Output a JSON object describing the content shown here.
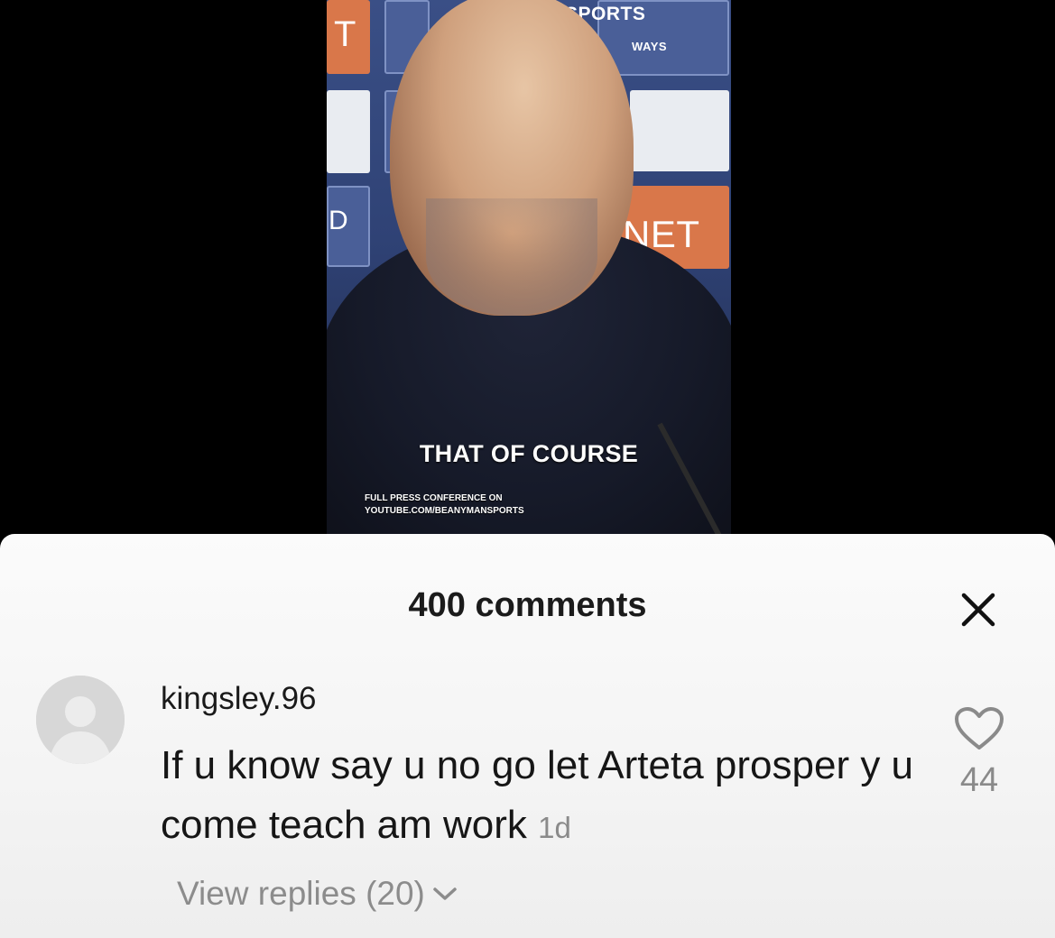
{
  "video": {
    "board_texts": [
      "SPORTS",
      "WAYS",
      "NET",
      "T",
      "D"
    ],
    "caption": "THAT OF COURSE",
    "watermark_line1": "FULL PRESS CONFERENCE ON",
    "watermark_line2": "YOUTUBE.COM/BEANYMANSPORTS"
  },
  "comments_sheet": {
    "title": "400 comments",
    "close_icon": "close-icon",
    "comments": [
      {
        "username": "kingsley.96",
        "text": "If u know say u no go let Arteta prosper y u come teach am work",
        "time": "1d",
        "likes": "44",
        "like_icon": "heart-outline-icon",
        "view_replies": "View replies (20)",
        "expand_icon": "chevron-down-icon"
      }
    ]
  },
  "colors": {
    "sheet_background": "#f6f6f6",
    "primary_text": "#161616",
    "secondary_text": "#8a8a8a",
    "avatar_placeholder": "#d7d7d7"
  }
}
